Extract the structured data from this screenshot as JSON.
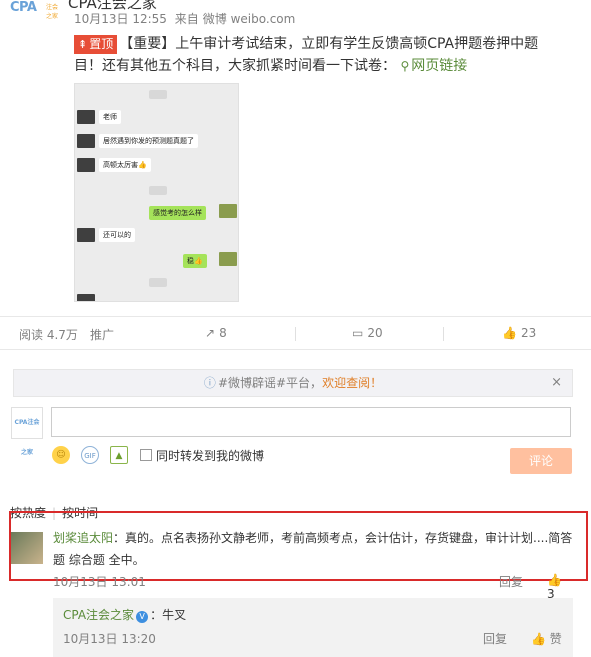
{
  "header": {
    "logo_text": "CPA",
    "logo_sub": "注会之家",
    "name_partial": "CPA注会之家",
    "date": "10月13日 12:55",
    "source_prefix": "来自",
    "source": "微博 weibo.com"
  },
  "post": {
    "top_tag": "置顶",
    "text": "【重要】上午审计考试结束，立即有学生反馈高顿CPA押题卷押中题目！还有其他五个科目，大家抓紧时间看一下试卷：",
    "link_label": "网页链接"
  },
  "chat_image": {
    "messages": [
      {
        "text": "老师"
      },
      {
        "text": "居然遇到你发的预测题真题了"
      },
      {
        "text": "高顿太厉害👍"
      },
      {
        "text": "感觉考的怎么样"
      },
      {
        "text": "还可以的"
      },
      {
        "text": "稳👍"
      }
    ]
  },
  "stats": {
    "reads": "阅读 4.7万",
    "promote": "推广",
    "forwards": "8",
    "comments": "20",
    "likes": "23"
  },
  "notice": {
    "prefix": "#微博辟谣#平台，",
    "highlight": "欢迎查阅！",
    "close": "×"
  },
  "composer": {
    "avatar_text": "CPA注会之家",
    "forward_label": "同时转发到我的微博",
    "submit_label": "评论"
  },
  "sort": {
    "by_hot": "按热度",
    "by_time": "按时间"
  },
  "comment": {
    "user": "划桨追太阳",
    "text": "：真的。点名表扬孙文静老师，考前高频考点，会计估计，存货键盘，审计计划....简答题 综合题 全中。",
    "time": "10月13日 13:01",
    "reply_label": "回复",
    "like_count": "3"
  },
  "sub_comment": {
    "user": "CPA注会之家",
    "text": "：牛叉",
    "time": "10月13日 13:20",
    "reply_label": "回复",
    "like_label": "赞"
  },
  "colors": {
    "accent_green": "#5a8b3a",
    "alert_red": "#d92a2a",
    "top_tag": "#e74d36",
    "submit_disabled": "#ffc09f"
  }
}
